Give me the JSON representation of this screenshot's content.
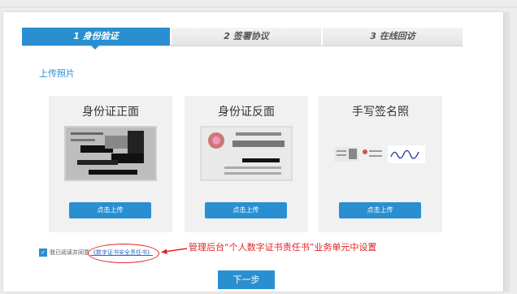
{
  "steps": [
    {
      "label": "1 身份验证"
    },
    {
      "label": "2 签署协议"
    },
    {
      "label": "3 在线回访"
    }
  ],
  "section_title": "上传照片",
  "cards": [
    {
      "title": "身份证正面",
      "button": "点击上传"
    },
    {
      "title": "身份证反面",
      "button": "点击上传"
    },
    {
      "title": "手写签名照",
      "button": "点击上传"
    }
  ],
  "agreement": {
    "checked": true,
    "prefix": "我已阅读并同意",
    "link": "《数字证书安全责任书》"
  },
  "annotation": "管理后台“个人数字证书责任书”业务单元中设置",
  "next_button": "下一步",
  "colors": {
    "accent": "#2a8fd0",
    "annotation": "#e52222"
  }
}
